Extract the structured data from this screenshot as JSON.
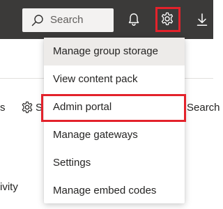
{
  "header": {
    "search_placeholder": "Search",
    "icons": {
      "search": "search-icon",
      "notifications": "bell-icon",
      "settings": "gear-icon",
      "download": "download-icon"
    },
    "background_color": "#3b3a39",
    "highlight_color": "#e3222b"
  },
  "background_page": {
    "fragment_left": "s",
    "fragment_settings": "S",
    "fragment_search": "Search",
    "fragment_activity": "ivity"
  },
  "settings_menu": {
    "items": [
      {
        "label": "Manage group storage",
        "hovered": true
      },
      {
        "label": "View content pack",
        "hovered": false
      },
      {
        "label": "Admin portal",
        "hovered": false,
        "highlighted": true
      },
      {
        "label": "Manage gateways",
        "hovered": false
      },
      {
        "label": "Settings",
        "hovered": false
      },
      {
        "label": "Manage embed codes",
        "hovered": false
      }
    ]
  }
}
